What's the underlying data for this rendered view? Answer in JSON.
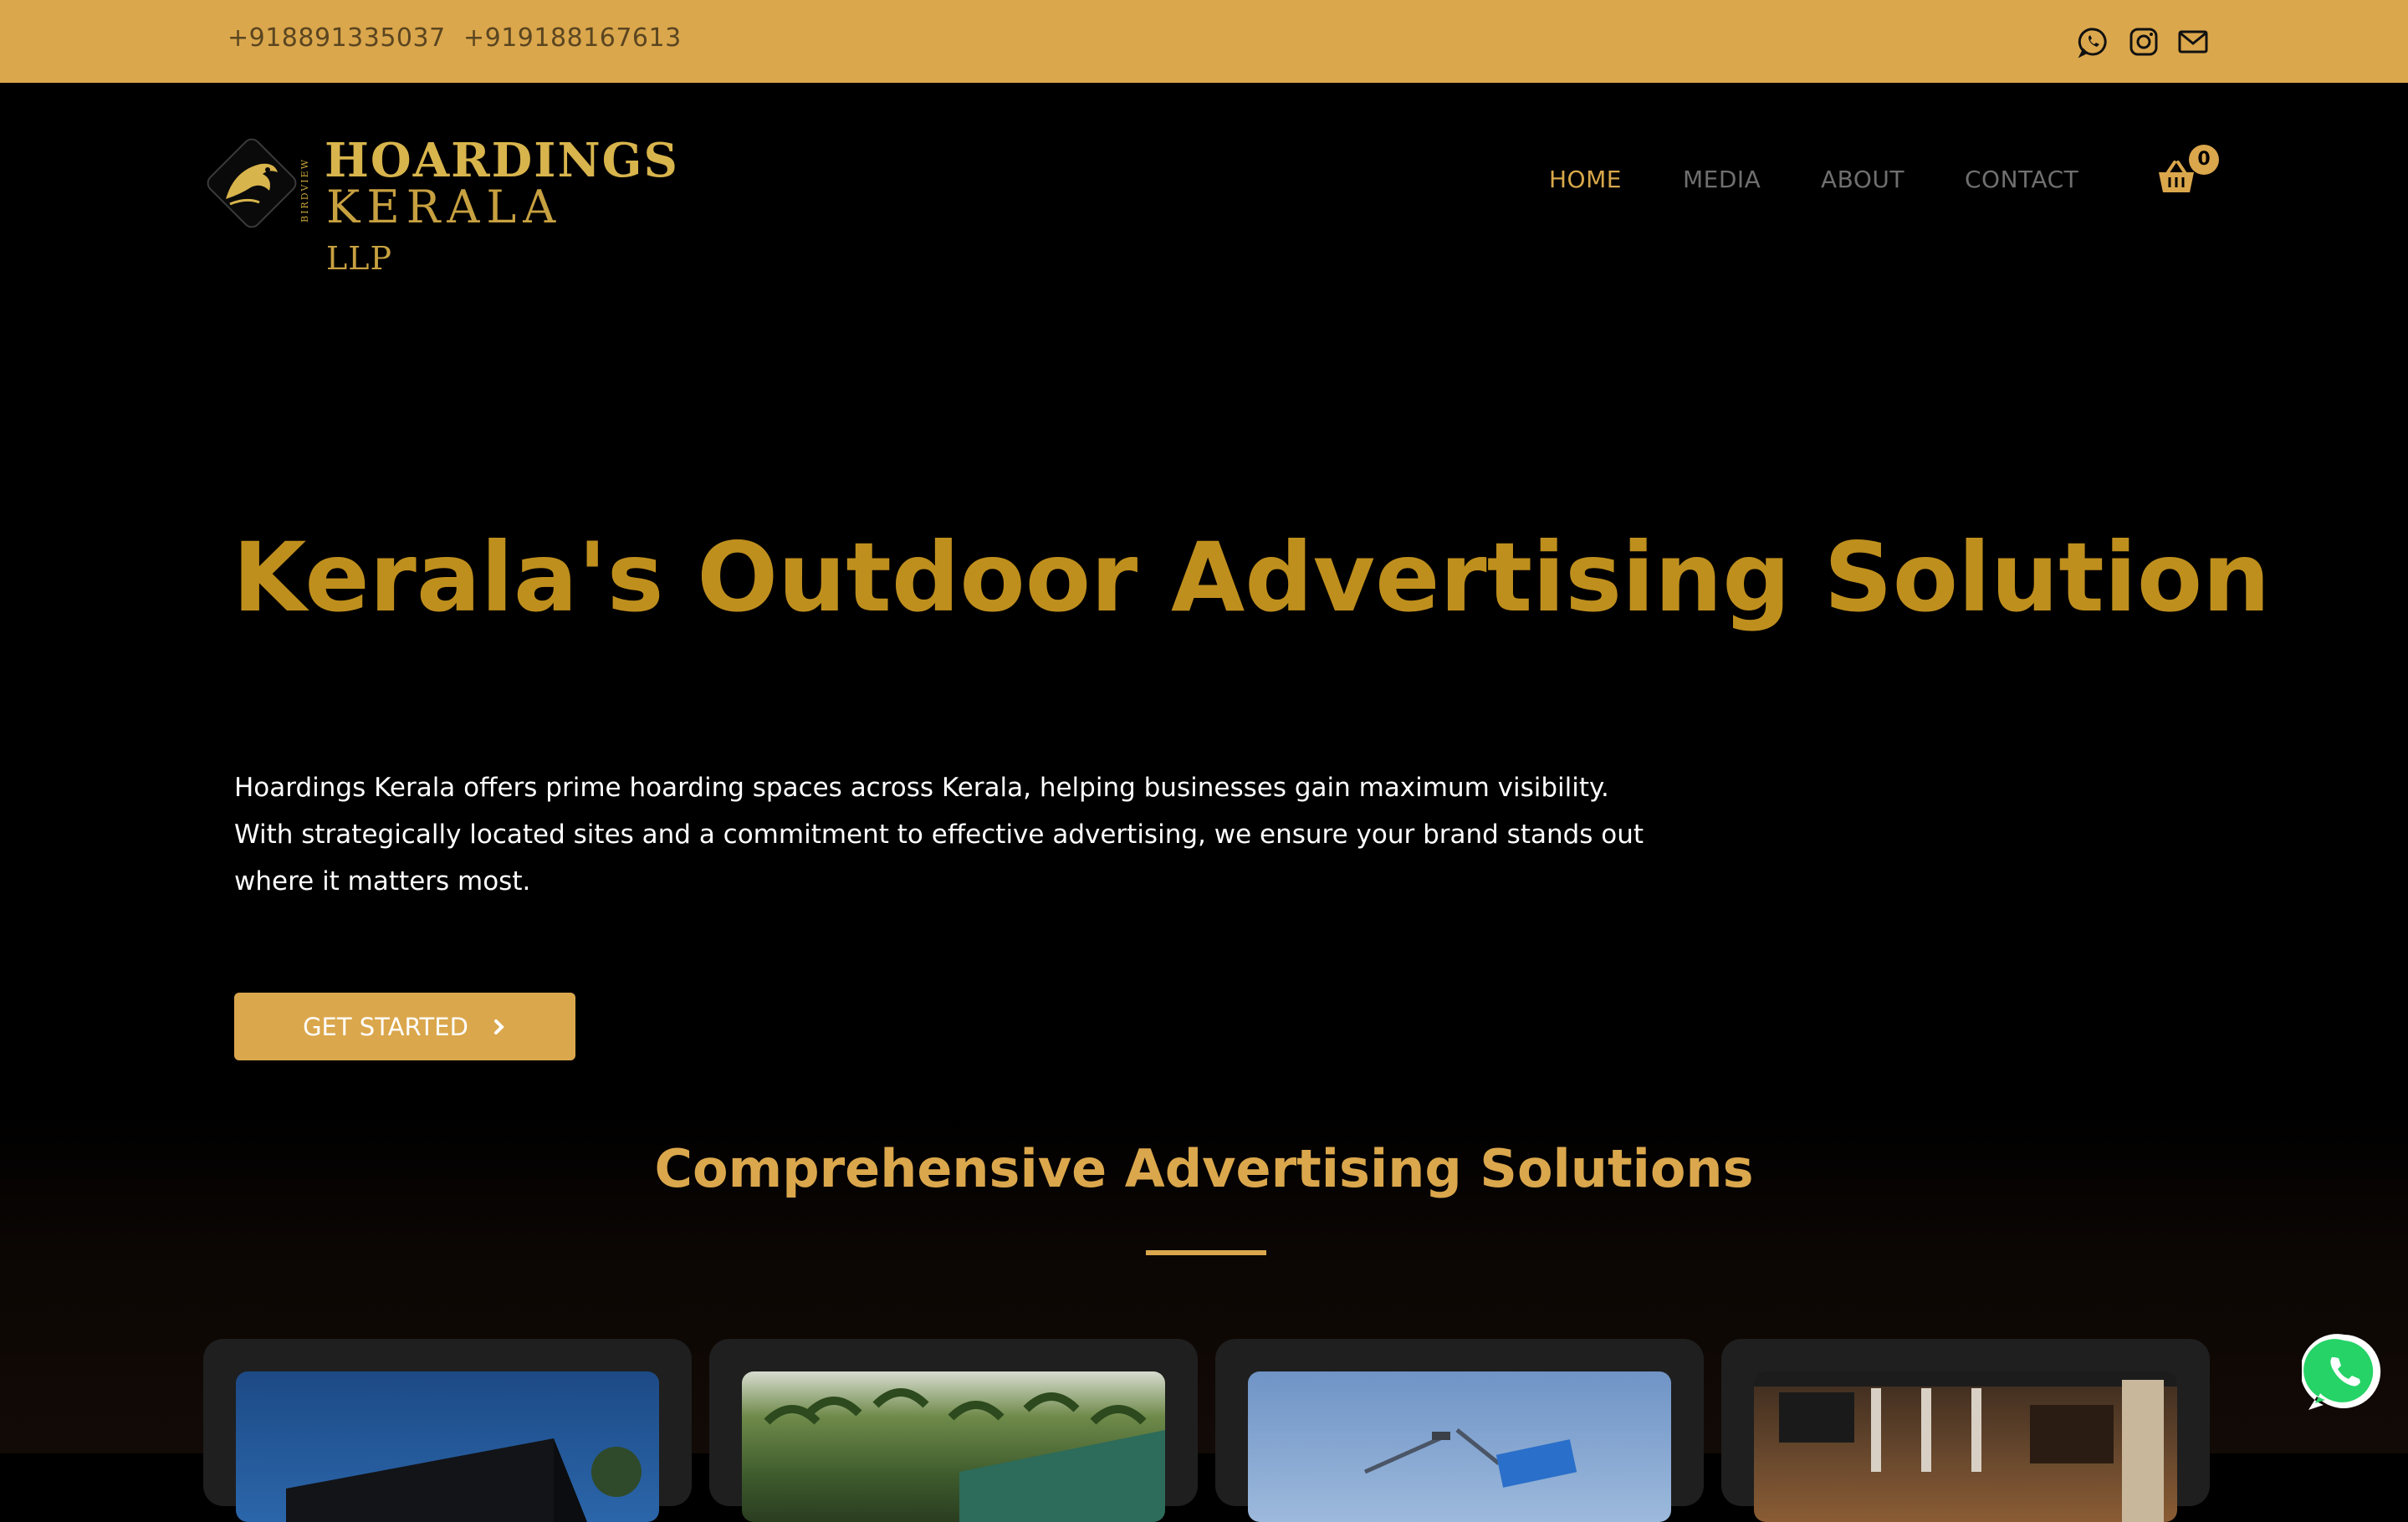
{
  "topbar": {
    "phone1": "+918891335037",
    "phone2": "+919188167613",
    "icons": [
      "whatsapp-icon",
      "instagram-icon",
      "mail-icon"
    ],
    "background": "#dba74c"
  },
  "header": {
    "logo": {
      "line1": "HOARDINGS",
      "line2": "KERALA",
      "suffix": "LLP",
      "side_text": "BIRDVIEW"
    },
    "nav": [
      {
        "label": "HOME",
        "active": true
      },
      {
        "label": "MEDIA",
        "active": false
      },
      {
        "label": "ABOUT",
        "active": false
      },
      {
        "label": "CONTACT",
        "active": false
      }
    ],
    "cart_count": "0"
  },
  "hero": {
    "title": "Kerala's Outdoor Advertising Solution",
    "description": "Hoardings Kerala offers prime hoarding spaces across Kerala, helping businesses gain maximum visibility. With strategically located sites and a commitment to effective advertising, we ensure your brand stands out where it matters most.",
    "cta_label": "GET STARTED"
  },
  "section": {
    "title": "Comprehensive Advertising Solutions",
    "cards": [
      "building-billboard-image",
      "palm-trees-hoarding-image",
      "sky-billboard-image",
      "mall-interior-image"
    ]
  },
  "colors": {
    "accent": "#dba74c",
    "title_gold": "#bf8f1d",
    "background": "#000000",
    "card_bg": "#1f1f1f"
  }
}
